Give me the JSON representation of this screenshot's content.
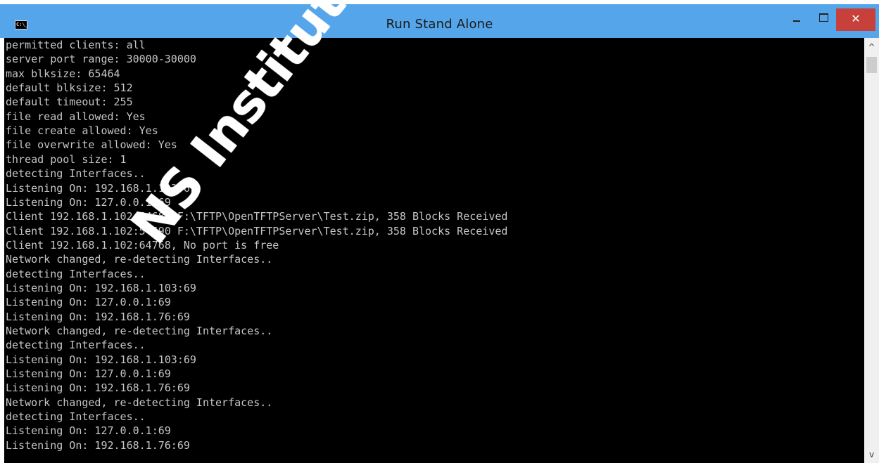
{
  "window": {
    "title": "Run Stand Alone",
    "app_icon_text": "C:\\_",
    "minimize_glyph": "",
    "close_glyph": "✕"
  },
  "console": {
    "lines": [
      "permitted clients: all",
      "server port range: 30000-30000",
      "max blksize: 65464",
      "default blksize: 512",
      "default timeout: 255",
      "file read allowed: Yes",
      "file create allowed: Yes",
      "file overwrite allowed: Yes",
      "thread pool size: 1",
      "detecting Interfaces..",
      "Listening On: 192.168.1.103:69",
      "Listening On: 127.0.0.1:69",
      "Client 192.168.1.102:54689 F:\\TFTP\\OpenTFTPServer\\Test.zip, 358 Blocks Received",
      "Client 192.168.1.102:54690 F:\\TFTP\\OpenTFTPServer\\Test.zip, 358 Blocks Received",
      "Client 192.168.1.102:64768, No port is free",
      "Network changed, re-detecting Interfaces..",
      "detecting Interfaces..",
      "Listening On: 192.168.1.103:69",
      "Listening On: 127.0.0.1:69",
      "Listening On: 192.168.1.76:69",
      "Network changed, re-detecting Interfaces..",
      "detecting Interfaces..",
      "Listening On: 192.168.1.103:69",
      "Listening On: 127.0.0.1:69",
      "Listening On: 192.168.1.76:69",
      "Network changed, re-detecting Interfaces..",
      "detecting Interfaces..",
      "Listening On: 127.0.0.1:69",
      "Listening On: 192.168.1.76:69"
    ]
  },
  "scrollbar": {
    "up_glyph": "^",
    "down_glyph": "v"
  },
  "watermark": {
    "text": "NS Institute, Author ret"
  },
  "colors": {
    "titlebar": "#55a5ea",
    "close_button": "#c8403b",
    "console_bg": "#000000",
    "console_text": "#c6c6c6"
  }
}
